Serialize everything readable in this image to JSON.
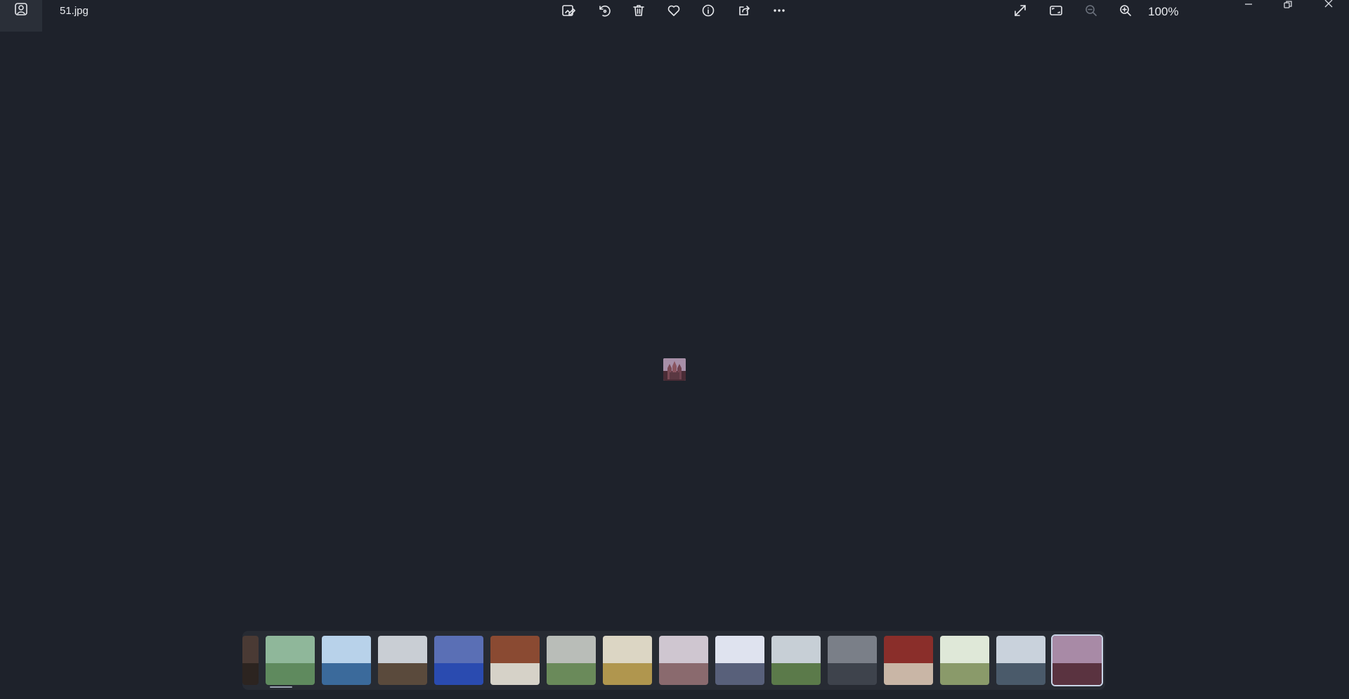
{
  "titlebar": {
    "file_name": "51.jpg",
    "zoom_level": "100%"
  },
  "toolbar": [
    {
      "name": "edit-image-button",
      "icon": "edit-image-icon"
    },
    {
      "name": "rotate-button",
      "icon": "rotate-icon"
    },
    {
      "name": "delete-button",
      "icon": "trash-icon"
    },
    {
      "name": "favorite-button",
      "icon": "heart-icon"
    },
    {
      "name": "file-info-button",
      "icon": "info-icon"
    },
    {
      "name": "share-button",
      "icon": "share-icon"
    },
    {
      "name": "more-options-button",
      "icon": "more-icon"
    }
  ],
  "view_controls": [
    {
      "name": "fullscreen-button",
      "icon": "expand-icon"
    },
    {
      "name": "fit-to-window-button",
      "icon": "fit-icon"
    },
    {
      "name": "zoom-out-button",
      "icon": "zoom-out-icon",
      "disabled": true
    },
    {
      "name": "zoom-in-button",
      "icon": "zoom-in-icon"
    }
  ],
  "window_controls": [
    "minimize-icon",
    "restore-icon",
    "close-icon"
  ],
  "filmstrip": {
    "selected_index": 15,
    "thumbnails": [
      {
        "sky": "#4a3a34",
        "ground": "#2c2420"
      },
      {
        "sky": "#8fb79a",
        "ground": "#5f8a5e"
      },
      {
        "sky": "#b8d2ea",
        "ground": "#3b6a9b"
      },
      {
        "sky": "#c9ced4",
        "ground": "#5a4a3c"
      },
      {
        "sky": "#5a6fb5",
        "ground": "#2a4bb0"
      },
      {
        "sky": "#8a4a32",
        "ground": "#d6d2c8"
      },
      {
        "sky": "#b9bdb8",
        "ground": "#6a8a5a"
      },
      {
        "sky": "#dcd6c4",
        "ground": "#b0964e"
      },
      {
        "sky": "#cfc6d0",
        "ground": "#8a6a6e"
      },
      {
        "sky": "#dfe3ef",
        "ground": "#58607a"
      },
      {
        "sky": "#c7cfd6",
        "ground": "#5b7a4a"
      },
      {
        "sky": "#7a7f88",
        "ground": "#3e434c"
      },
      {
        "sky": "#8a2e2a",
        "ground": "#c9b6a6"
      },
      {
        "sky": "#dfe8d8",
        "ground": "#8a9a6a"
      },
      {
        "sky": "#c9d2dc",
        "ground": "#4a5a6a"
      },
      {
        "sky": "#a88aa6",
        "ground": "#5a3340"
      }
    ]
  }
}
